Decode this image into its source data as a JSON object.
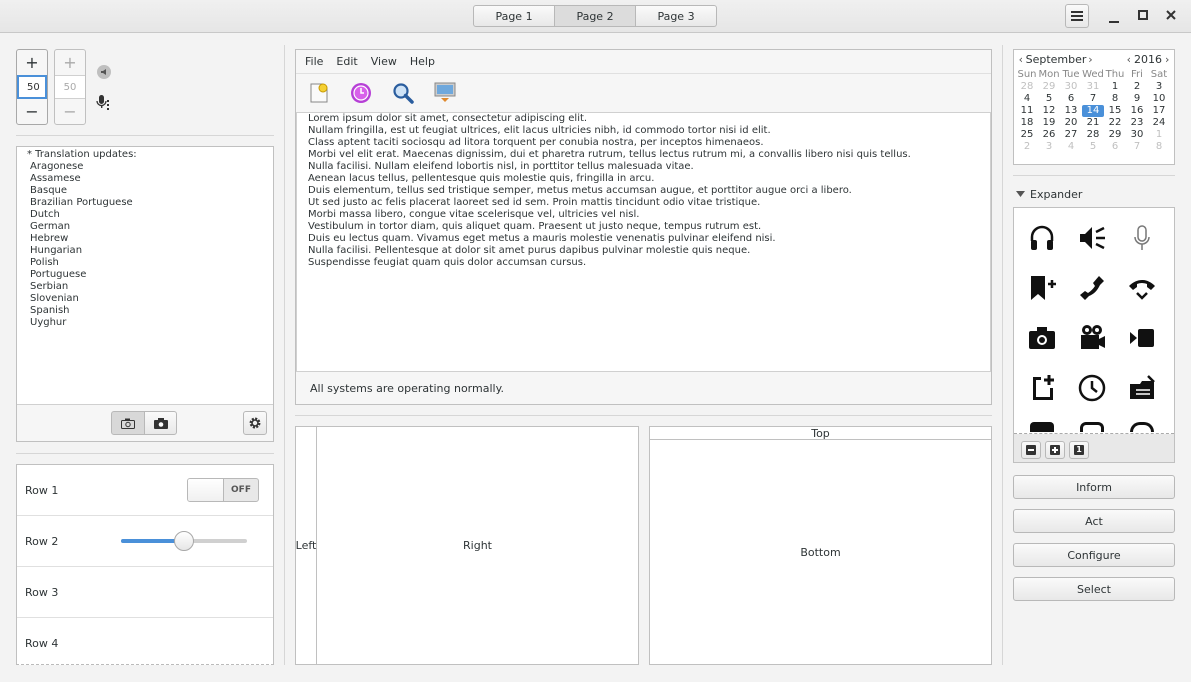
{
  "header": {
    "pages": [
      "Page 1",
      "Page 2",
      "Page 3"
    ],
    "active_page": 1,
    "menu_icon": "hamburger-menu-icon",
    "window_controls": [
      "minimize-icon",
      "maximize-icon",
      "close-icon"
    ]
  },
  "spinners": {
    "active_value": "50",
    "inactive_value": "50",
    "plus": "+",
    "minus": "−"
  },
  "translations": {
    "heading": "* Translation updates:",
    "languages": [
      "Aragonese",
      "Assamese",
      "Basque",
      "Brazilian Portuguese",
      "Dutch",
      "German",
      "Hebrew",
      "Hungarian",
      "Polish",
      "Portuguese",
      "Serbian",
      "Slovenian",
      "Spanish",
      "Uyghur"
    ]
  },
  "list_rows": {
    "row1": "Row 1",
    "row2": "Row 2",
    "row3": "Row 3",
    "row4": "Row 4",
    "switch_label": "OFF",
    "slider_value": 0.5
  },
  "editor": {
    "menu": [
      "File",
      "Edit",
      "View",
      "Help"
    ],
    "lines": [
      "Lorem ipsum dolor sit amet, consectetur adipiscing elit.",
      "Nullam fringilla, est ut feugiat ultrices, elit lacus ultricies nibh, id commodo tortor nisi id elit.",
      "Class aptent taciti sociosqu ad litora torquent per conubia nostra, per inceptos himenaeos.",
      "Morbi vel elit erat. Maecenas dignissim, dui et pharetra rutrum, tellus lectus rutrum mi, a convallis libero nisi quis tellus.",
      "Nulla facilisi. Nullam eleifend lobortis nisl, in porttitor tellus malesuada vitae.",
      "Aenean lacus tellus, pellentesque quis molestie quis, fringilla in arcu.",
      "Duis elementum, tellus sed tristique semper, metus metus accumsan augue, et porttitor augue orci a libero.",
      "Ut sed justo ac felis placerat laoreet sed id sem. Proin mattis tincidunt odio vitae tristique.",
      "Morbi massa libero, congue vitae scelerisque vel, ultricies vel nisl.",
      "Vestibulum in tortor diam, quis aliquet quam. Praesent ut justo neque, tempus rutrum est.",
      "Duis eu lectus quam. Vivamus eget metus a mauris molestie venenatis pulvinar eleifend nisi.",
      "Nulla facilisi. Pellentesque at dolor sit amet purus dapibus pulvinar molestie quis neque.",
      "Suspendisse feugiat quam quis dolor accumsan cursus."
    ],
    "status": "All systems are operating normally."
  },
  "panes": {
    "left": "Left",
    "right": "Right",
    "top": "Top",
    "bottom": "Bottom"
  },
  "calendar": {
    "month": "September",
    "year": "2016",
    "weekdays": [
      "Sun",
      "Mon",
      "Tue",
      "Wed",
      "Thu",
      "Fri",
      "Sat"
    ],
    "weeks": [
      [
        "28",
        "29",
        "30",
        "31",
        "1",
        "2",
        "3"
      ],
      [
        "4",
        "5",
        "6",
        "7",
        "8",
        "9",
        "10"
      ],
      [
        "11",
        "12",
        "13",
        "14",
        "15",
        "16",
        "17"
      ],
      [
        "18",
        "19",
        "20",
        "21",
        "22",
        "23",
        "24"
      ],
      [
        "25",
        "26",
        "27",
        "28",
        "29",
        "30",
        "1"
      ],
      [
        "2",
        "3",
        "4",
        "5",
        "6",
        "7",
        "8"
      ]
    ],
    "selected": "14"
  },
  "expander": {
    "label": "Expander",
    "icons": [
      "headphones-icon",
      "speaker-mute-icon",
      "microphone-icon",
      "bookmark-add-icon",
      "phone-icon",
      "hang-up-icon",
      "camera-icon",
      "video-camera-icon",
      "video-call-icon",
      "new-document-icon",
      "clock-icon",
      "folder-open-icon"
    ],
    "toolbar_badge": "1"
  },
  "actions": {
    "inform": "Inform",
    "act": "Act",
    "configure": "Configure",
    "select": "Select"
  },
  "accent_color": "#4a90d9"
}
